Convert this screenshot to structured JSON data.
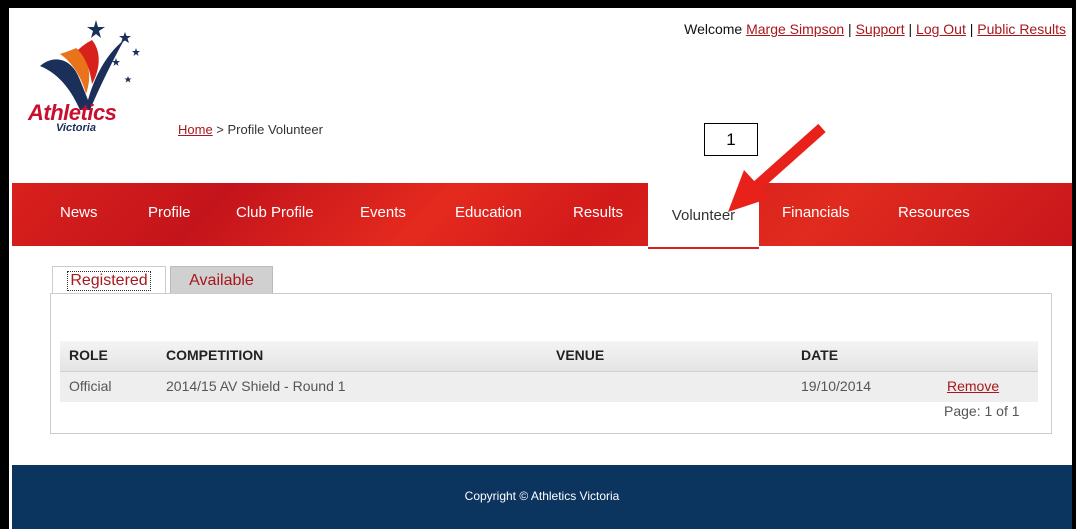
{
  "logo": {
    "text": "Athletics",
    "sub": "Victoria",
    "colors": {
      "red": "#c8102e",
      "navy": "#1a2f5a"
    }
  },
  "topbar": {
    "welcome": "Welcome",
    "user": "Marge Simpson",
    "sep": " | ",
    "support": "Support",
    "logout": "Log Out",
    "public_results": "Public Results"
  },
  "breadcrumb": {
    "home": "Home",
    "separator": " > ",
    "current": "Profile Volunteer"
  },
  "nav": {
    "items": [
      {
        "label": "News"
      },
      {
        "label": "Profile"
      },
      {
        "label": "Club Profile"
      },
      {
        "label": "Events"
      },
      {
        "label": "Education"
      },
      {
        "label": "Results"
      },
      {
        "label": "Volunteer"
      },
      {
        "label": "Financials"
      },
      {
        "label": "Resources"
      }
    ],
    "active": "Volunteer",
    "color": "#d9211c"
  },
  "callout": {
    "label": "1",
    "arrow_color": "#e8221b"
  },
  "tabs": {
    "registered": "Registered",
    "available": "Available"
  },
  "table": {
    "headers": {
      "role": "ROLE",
      "competition": "COMPETITION",
      "venue": "VENUE",
      "date": "DATE"
    },
    "rows": [
      {
        "role": "Official",
        "competition": "2014/15 AV Shield - Round 1",
        "venue": "",
        "date": "19/10/2014",
        "action": "Remove"
      }
    ]
  },
  "pager": {
    "text": "Page: 1 of 1"
  },
  "footer": {
    "copyright": "Copyright © Athletics Victoria",
    "color": "#0b345f"
  }
}
